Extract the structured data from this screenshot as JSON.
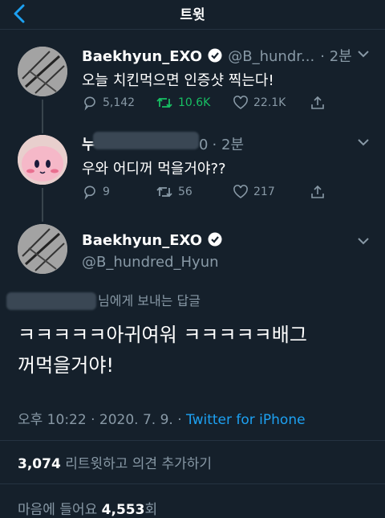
{
  "header": {
    "title": "트윗"
  },
  "tweets": [
    {
      "name": "Baekhyun_EXO",
      "handle": "@B_hundr...",
      "time": "· 2분",
      "text": "오늘 치킨먹으면 인증샷 찍는다!",
      "reply_count": "5,142",
      "retweet_count": "10.6K",
      "like_count": "22.1K"
    },
    {
      "name_visible": "누",
      "handle_tail": "0",
      "time": "· 2분",
      "text": "우와 어디꺼 먹을거야??",
      "reply_count": "9",
      "retweet_count": "56",
      "like_count": "217"
    }
  ],
  "main_tweet": {
    "name": "Baekhyun_EXO",
    "handle": "@B_hundred_Hyun",
    "reply_to_suffix": "님에게 보내는 답글",
    "text_line1": "ㅋㅋㅋㅋㅋ아귀여워 ㅋㅋㅋㅋㅋ배그",
    "text_line2": "꺼먹을거야!",
    "meta_time": "오후 10:22 · 2020. 7. 9. ·",
    "source": "Twitter for iPhone",
    "retweets_count": "3,074",
    "retweets_label": "리트윗하고 의견 추가하기",
    "likes_label": "마음에 들어요",
    "likes_count": "4,553",
    "likes_suffix": "회"
  },
  "colors": {
    "background": "#15202b",
    "accent": "#1da1f2",
    "retweet_active": "#17bf63",
    "muted": "#8899a6"
  }
}
